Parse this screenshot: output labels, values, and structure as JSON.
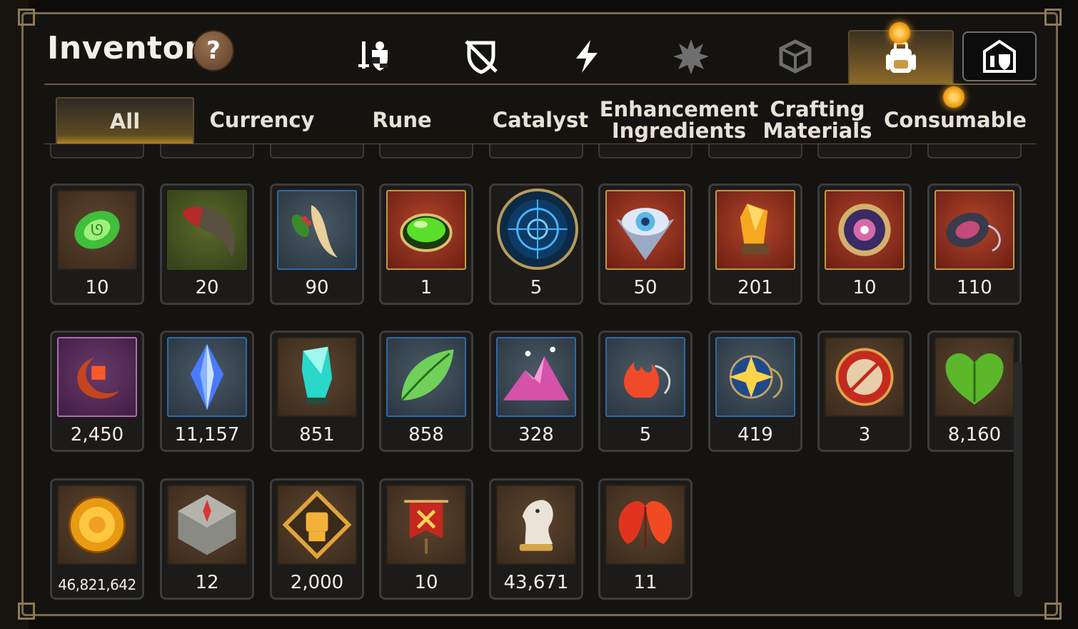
{
  "title": "Inventory",
  "help_symbol": "?",
  "category_tabs": [
    {
      "icon": "sword-shield-icon"
    },
    {
      "icon": "broken-shield-icon"
    },
    {
      "icon": "lightning-icon"
    },
    {
      "icon": "burst-icon"
    },
    {
      "icon": "cube-icon"
    },
    {
      "icon": "backpack-icon",
      "active": true
    },
    {
      "icon": "guild-crest-icon"
    }
  ],
  "sub_tabs": [
    "All",
    "Currency",
    "Rune",
    "Catalyst",
    "Enhancement Ingredients",
    "Crafting Materials",
    "Consumable"
  ],
  "items": [
    {
      "icon": "green-jade-icon",
      "qty": "10"
    },
    {
      "icon": "claw-horn-icon",
      "qty": "20"
    },
    {
      "icon": "ginseng-root-icon",
      "qty": "90"
    },
    {
      "icon": "green-potion-icon",
      "qty": "1"
    },
    {
      "icon": "blue-portal-icon",
      "qty": "5"
    },
    {
      "icon": "eye-gem-icon",
      "qty": "50"
    },
    {
      "icon": "amber-crystal-icon",
      "qty": "201"
    },
    {
      "icon": "mystic-disc-icon",
      "qty": "10"
    },
    {
      "icon": "pendant-icon",
      "qty": "110"
    },
    {
      "icon": "crescent-flower-icon",
      "qty": "2,450"
    },
    {
      "icon": "blue-crystal-icon",
      "qty": "11,157"
    },
    {
      "icon": "teal-crystal-icon",
      "qty": "851"
    },
    {
      "icon": "leaf-icon",
      "qty": "858"
    },
    {
      "icon": "pink-mountain-icon",
      "qty": "328"
    },
    {
      "icon": "flame-pendant-icon",
      "qty": "5"
    },
    {
      "icon": "star-pendant-icon",
      "qty": "419"
    },
    {
      "icon": "red-seal-icon",
      "qty": "3"
    },
    {
      "icon": "heart-leaf-icon",
      "qty": "8,160"
    },
    {
      "icon": "gold-coin-icon",
      "qty": "46,821,642"
    },
    {
      "icon": "compass-stone-icon",
      "qty": "12"
    },
    {
      "icon": "fist-emblem-icon",
      "qty": "2,000"
    },
    {
      "icon": "war-banner-icon",
      "qty": "10"
    },
    {
      "icon": "chess-knight-icon",
      "qty": "43,671"
    },
    {
      "icon": "maple-leaves-icon",
      "qty": "11"
    }
  ]
}
